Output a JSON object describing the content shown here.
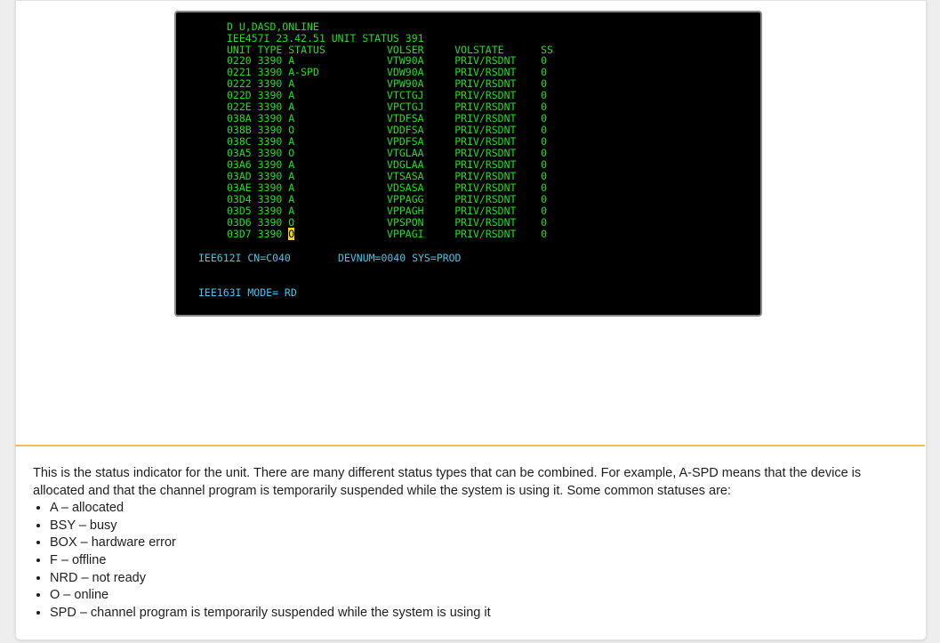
{
  "terminal": {
    "command": "D U,DASD,ONLINE",
    "message": "IEE457I 23.42.51 UNIT STATUS 391",
    "header": "UNIT TYPE STATUS          VOLSER     VOLSTATE      SS",
    "rows": [
      {
        "unit": "0220",
        "type": "3390",
        "status": "A",
        "volser": "VTW90A",
        "volstate": "PRIV/RSDNT",
        "ss": "0"
      },
      {
        "unit": "0221",
        "type": "3390",
        "status": "A-SPD",
        "volser": "VDW90A",
        "volstate": "PRIV/RSDNT",
        "ss": "0"
      },
      {
        "unit": "0222",
        "type": "3390",
        "status": "A",
        "volser": "VPW90A",
        "volstate": "PRIV/RSDNT",
        "ss": "0"
      },
      {
        "unit": "022D",
        "type": "3390",
        "status": "A",
        "volser": "VTCTGJ",
        "volstate": "PRIV/RSDNT",
        "ss": "0"
      },
      {
        "unit": "022E",
        "type": "3390",
        "status": "A",
        "volser": "VPCTGJ",
        "volstate": "PRIV/RSDNT",
        "ss": "0"
      },
      {
        "unit": "038A",
        "type": "3390",
        "status": "A",
        "volser": "VTDFSA",
        "volstate": "PRIV/RSDNT",
        "ss": "0"
      },
      {
        "unit": "038B",
        "type": "3390",
        "status": "O",
        "volser": "VDDFSA",
        "volstate": "PRIV/RSDNT",
        "ss": "0"
      },
      {
        "unit": "038C",
        "type": "3390",
        "status": "A",
        "volser": "VPDFSA",
        "volstate": "PRIV/RSDNT",
        "ss": "0"
      },
      {
        "unit": "03A5",
        "type": "3390",
        "status": "O",
        "volser": "VTGLAA",
        "volstate": "PRIV/RSDNT",
        "ss": "0"
      },
      {
        "unit": "03A6",
        "type": "3390",
        "status": "A",
        "volser": "VDGLAA",
        "volstate": "PRIV/RSDNT",
        "ss": "0"
      },
      {
        "unit": "03AD",
        "type": "3390",
        "status": "A",
        "volser": "VTSASA",
        "volstate": "PRIV/RSDNT",
        "ss": "0"
      },
      {
        "unit": "03AE",
        "type": "3390",
        "status": "A",
        "volser": "VDSASA",
        "volstate": "PRIV/RSDNT",
        "ss": "0"
      },
      {
        "unit": "03D4",
        "type": "3390",
        "status": "A",
        "volser": "VPPAGG",
        "volstate": "PRIV/RSDNT",
        "ss": "0"
      },
      {
        "unit": "03D5",
        "type": "3390",
        "status": "A",
        "volser": "VPPAGH",
        "volstate": "PRIV/RSDNT",
        "ss": "0"
      },
      {
        "unit": "03D6",
        "type": "3390",
        "status": "O",
        "volser": "VPSPON",
        "volstate": "PRIV/RSDNT",
        "ss": "0"
      },
      {
        "unit": "03D7",
        "type": "3390",
        "status": "O",
        "volser": "VPPAGI",
        "volstate": "PRIV/RSDNT",
        "ss": "0",
        "highlighted": true
      }
    ],
    "cn_msg": "IEE612I CN=C040",
    "devnum_msg": "DEVNUM=0040 SYS=PROD",
    "mode_msg": "IEE163I MODE= RD"
  },
  "explanation": {
    "intro": "This is the status indicator for the unit. There are many different status types that can be combined. For example, A-SPD means that the device is allocated and that the channel program is temporarily suspended while the system is using it. Some common statuses are:",
    "items": [
      "A – allocated",
      "BSY – busy",
      "BOX – hardware error",
      "F – offline",
      "NRD – not ready",
      "O – online",
      "SPD – channel program is temporarily suspended while the system is using it"
    ]
  },
  "colors": {
    "terminal_bg": "#000000",
    "terminal_green": "#1fe01f",
    "terminal_cyan": "#45c6e8",
    "cursor_highlight": "#f2d21a",
    "divider": "#f0c14d"
  }
}
